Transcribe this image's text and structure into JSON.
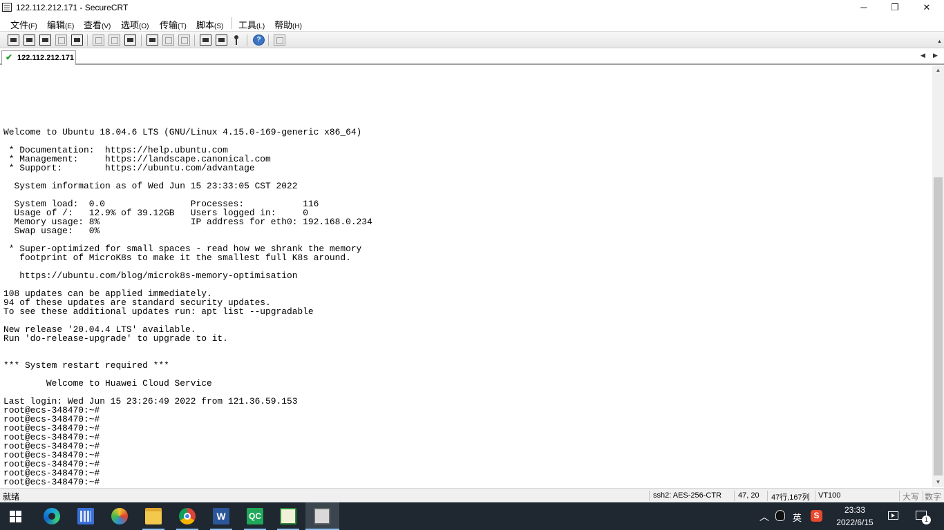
{
  "window": {
    "title": "122.112.212.171 - SecureCRT",
    "minimize": "─",
    "maximize": "❐",
    "close": "✕"
  },
  "menu": [
    {
      "label": "文件",
      "key": "(F)"
    },
    {
      "label": "编辑",
      "key": "(E)"
    },
    {
      "label": "查看",
      "key": "(V)"
    },
    {
      "label": "选项",
      "key": "(O)"
    },
    {
      "label": "传输",
      "key": "(T)"
    },
    {
      "label": "脚本",
      "key": "(S)"
    },
    {
      "label": "工具",
      "key": "(L)"
    },
    {
      "label": "帮助",
      "key": "(H)"
    }
  ],
  "toolbar": {
    "help_glyph": "?",
    "scroll_up": "▲"
  },
  "tabs": {
    "active_label": "122.112.212.171",
    "check": "✔",
    "arrow_left": "◀",
    "arrow_right": "▶"
  },
  "terminal": {
    "lines": [
      "Welcome to Ubuntu 18.04.6 LTS (GNU/Linux 4.15.0-169-generic x86_64)",
      "",
      " * Documentation:  https://help.ubuntu.com",
      " * Management:     https://landscape.canonical.com",
      " * Support:        https://ubuntu.com/advantage",
      "",
      "  System information as of Wed Jun 15 23:33:05 CST 2022",
      "",
      "  System load:  0.0                Processes:           116",
      "  Usage of /:   12.9% of 39.12GB   Users logged in:     0",
      "  Memory usage: 8%                 IP address for eth0: 192.168.0.234",
      "  Swap usage:   0%",
      "",
      " * Super-optimized for small spaces - read how we shrank the memory",
      "   footprint of MicroK8s to make it the smallest full K8s around.",
      "",
      "   https://ubuntu.com/blog/microk8s-memory-optimisation",
      "",
      "108 updates can be applied immediately.",
      "94 of these updates are standard security updates.",
      "To see these additional updates run: apt list --upgradable",
      "",
      "New release '20.04.4 LTS' available.",
      "Run 'do-release-upgrade' to upgrade to it.",
      "",
      "",
      "*** System restart required ***",
      "",
      "        Welcome to Huawei Cloud Service",
      "",
      "Last login: Wed Jun 15 23:26:49 2022 from 121.36.59.153",
      "root@ecs-348470:~#",
      "root@ecs-348470:~#",
      "root@ecs-348470:~#",
      "root@ecs-348470:~#",
      "root@ecs-348470:~#",
      "root@ecs-348470:~#",
      "root@ecs-348470:~#",
      "root@ecs-348470:~#",
      "root@ecs-348470:~#"
    ],
    "scroll_up": "▲",
    "scroll_down": "▼"
  },
  "status": {
    "ready": "就绪",
    "protocol": "ssh2: AES-256-CTR",
    "cursor": "47,  20",
    "size": "47行,167列",
    "emulation": "VT100",
    "caps": "大写",
    "num": "数字"
  },
  "taskbar": {
    "word_letter": "W",
    "qc_letter": "QC",
    "tray_chevron": "︿",
    "ime": "英",
    "sogou_letter": "S",
    "time": "23:33",
    "date": "2022/6/15",
    "notification_count": "1"
  }
}
